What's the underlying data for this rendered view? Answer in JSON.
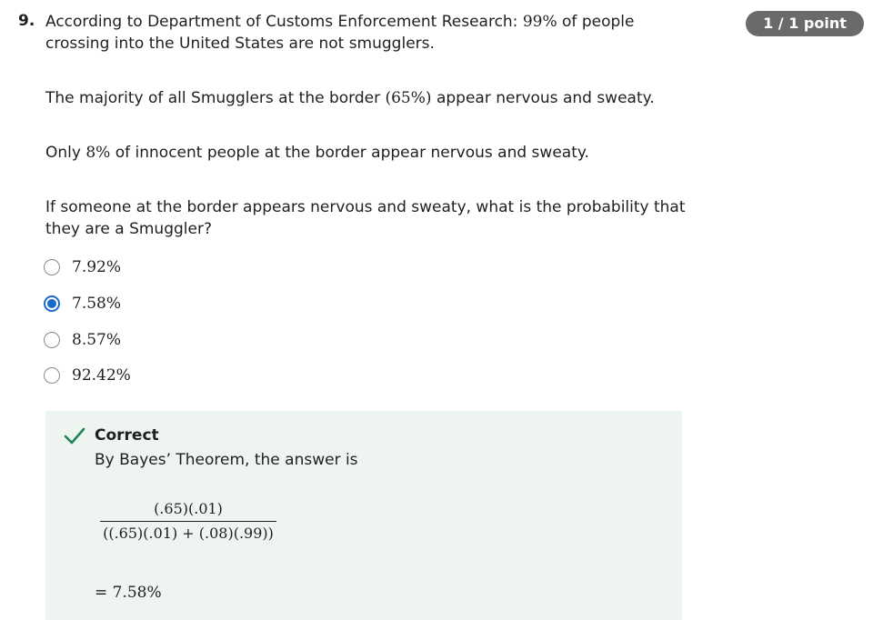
{
  "question": {
    "number": "9.",
    "points": "1 / 1 point",
    "intro_before": "According to Department of Customs Enforcement Research: ",
    "intro_pct": "99%",
    "intro_after": " of people crossing into the United States are not smugglers.",
    "p2_before": "The majority of all Smugglers at the border ",
    "p2_pct": "(65%)",
    "p2_after": " appear nervous and sweaty.",
    "p3_before": "Only ",
    "p3_pct": "8%",
    "p3_after": " of innocent people at the border appear nervous and sweaty.",
    "prompt": "If someone at the border appears nervous and sweaty, what is the probability that they are a Smuggler?"
  },
  "options": [
    {
      "label": "7.92%",
      "selected": false
    },
    {
      "label": "7.58%",
      "selected": true
    },
    {
      "label": "8.57%",
      "selected": false
    },
    {
      "label": "92.42%",
      "selected": false
    }
  ],
  "feedback": {
    "status": "Correct",
    "explanation": "By Bayes’ Theorem, the answer is",
    "numerator": "(.65)(.01)",
    "denominator": "((.65)(.01) + (.08)(.99))",
    "result": "= 7.58%",
    "color_accent": "#1f8354",
    "background": "#eef5f1"
  },
  "colors": {
    "radio_selected": "#1a6bcc",
    "badge_bg": "#6a6a6a"
  }
}
